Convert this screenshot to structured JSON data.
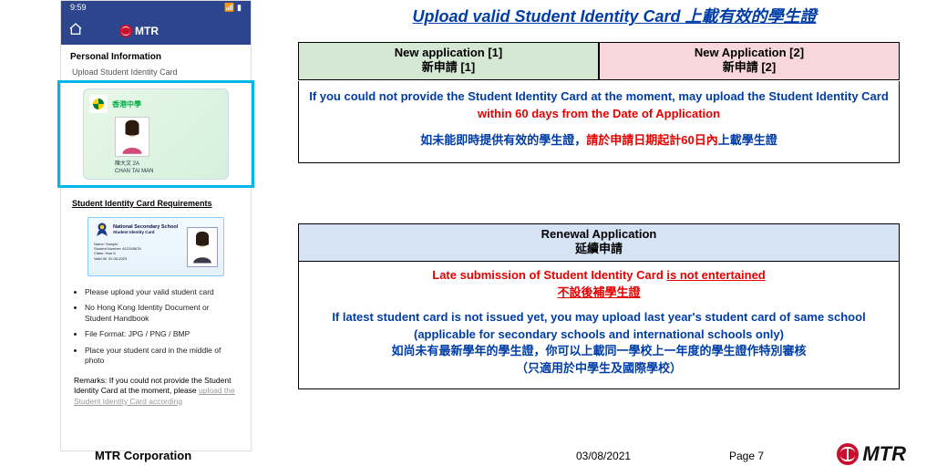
{
  "title": "Upload valid Student Identity Card  上載有效的學生證",
  "phone": {
    "time": "9:59",
    "brand": "MTR",
    "section": "Personal Information",
    "upload_label": "Upload Student Identity Card",
    "card": {
      "school": "香港中學",
      "name_line1": "陳大文  2A",
      "name_line2": "CHAN TAI MAN"
    },
    "req_title": "Student Identity Card Requirements",
    "sample": {
      "school": "National Secondary School",
      "sub": "Student Identity Card",
      "meta_name": "Name: Sample",
      "meta_num": "Student Number: A12345678",
      "meta_class": "Class: Year 6",
      "meta_valid": "Valid till: 31-08-2023"
    },
    "bullets": [
      "Please upload your valid student card",
      "No Hong Kong Identity Document or Student Handbook",
      "File Format: JPG / PNG / BMP",
      "Place your student card in the middle of photo"
    ],
    "remarks_prefix": "Remarks: If you could not provide the Student Identity Card at the moment, please ",
    "remarks_cutoff": "upload the Student Identity Card according"
  },
  "new_app": {
    "hdr1_en": "New application [1]",
    "hdr1_zh": "新申請 [1]",
    "hdr2_en": "New Application [2]",
    "hdr2_zh": "新申請 [2]",
    "line1a": "If you could not provide the Student Identity Card at the moment, may upload the Student Identity Card ",
    "line1b": "within 60 days from the Date of Application",
    "line2a": "如未能即時提供有效的學生證，",
    "line2b": "請於申請日期起計60日內",
    "line2c": "上載學生證"
  },
  "renewal": {
    "hdr_en": "Renewal Application",
    "hdr_zh": "延續申請",
    "l1a": "Late submission of Student Identity Card ",
    "l1b": "is not entertained",
    "l2": "不設後補學生證",
    "l3": "If latest student card is not issued yet, you may upload last year's student card of same school (applicable for secondary schools and international schools only)",
    "l4": "如尚未有最新學年的學生證，你可以上載同一學校上一年度的學生證作特別審核",
    "l5": "（只適用於中學生及國際學校）"
  },
  "footer": {
    "corp": "MTR Corporation",
    "date": "03/08/2021",
    "page": "Page 7",
    "brand": "MTR"
  }
}
